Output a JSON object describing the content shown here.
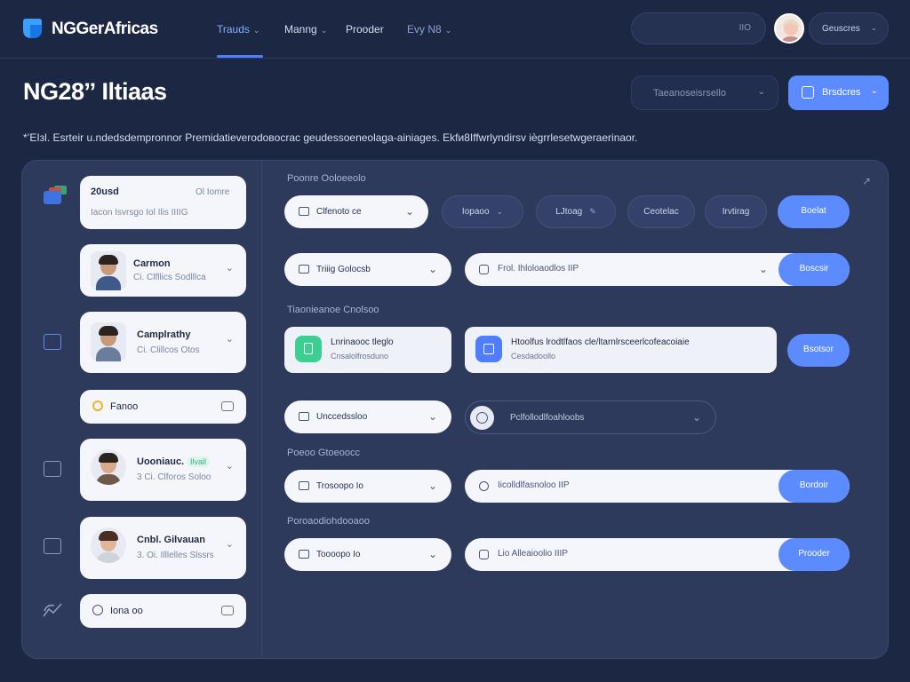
{
  "app": {
    "logo_text": "NGGerAfricas",
    "nav": [
      {
        "label": "Trauds",
        "active": true
      },
      {
        "label": "Manng"
      },
      {
        "label": "Prooder"
      },
      {
        "label": "Evy N8"
      }
    ],
    "search_hint": "IIO",
    "user_label": "Geuscres"
  },
  "header": {
    "title": "NG28ˮ Iltiaas",
    "select_label": "Taeanoseisrsello",
    "button_label": "Brsdcres",
    "description": "*’EIзl. Esrteir u.ndedsdempronnor Premidatieverodoвocrac geudessoeneolaga-ainiages. Ekfи8Iffwrlyndirsv iѐgrrlesetwgeraerinaor."
  },
  "sidebar": {
    "cards": [
      {
        "name": "20usd",
        "meta": "Ol Iomre",
        "sub": "Iacon Isvrsgo Iol Ilis IIIIG"
      },
      {
        "name": "Carmon",
        "sub": "Ci. Clfllics Sodlllca"
      },
      {
        "name": "Camplrathy",
        "sub": "Ci. Clillcos Otos"
      },
      {
        "name": "Fanoo"
      },
      {
        "name": "Uooniauc.",
        "badge": "Ilvall",
        "sub": "3 Ci. Clforos Soloo"
      },
      {
        "name": "Cnbl. Gilvauan",
        "sub": "3. Oi. Illlelles Slssrs"
      },
      {
        "name": "Iona oo"
      }
    ]
  },
  "main": {
    "section1_label": "Poonre Ooloeeolo",
    "row1": {
      "select": "Clfenoto ce",
      "pills": [
        "Iopaoo",
        "LJtoag",
        "Ceotelac",
        "Irvtirag"
      ],
      "button": "Boelat"
    },
    "row2": {
      "select": "Triiig Golocsb",
      "wide_text": "Frol. Ihloloaodlos  IIP",
      "button": "Boscsir"
    },
    "section2_label": "Tiaonieanoe Cnolsoo",
    "tcard1": {
      "t1": "Lnrinaooc tleglo",
      "t2": "Cnsalolfrosduno"
    },
    "tcard2": {
      "t1": "Htoolfus lrodtlfaos cle/ltarnlrsceerlcofeacoiaie",
      "t2": "Cesdadoollo"
    },
    "row3_button": "Bsotsor",
    "row4": {
      "select": "Unccedssloo",
      "outline_text": "Pclfollodlfoahloobs"
    },
    "section3_label": "Poeoo Gtoeoocc",
    "row5": {
      "select": "Trosoopo Io",
      "wide_text": "Iicolldlfasnoloo  IIP",
      "button": "Bordoir"
    },
    "section4_label": "Poroaodiohdooaoo",
    "row6": {
      "select": "Toooopo Io",
      "wide_text": "Lio Alleaioolio  IIIP",
      "button": "Prooder"
    }
  },
  "colors": {
    "background": "#1c2744",
    "panel": "#2d3a5b",
    "accent": "#5b8bff",
    "green": "#36b37e"
  }
}
